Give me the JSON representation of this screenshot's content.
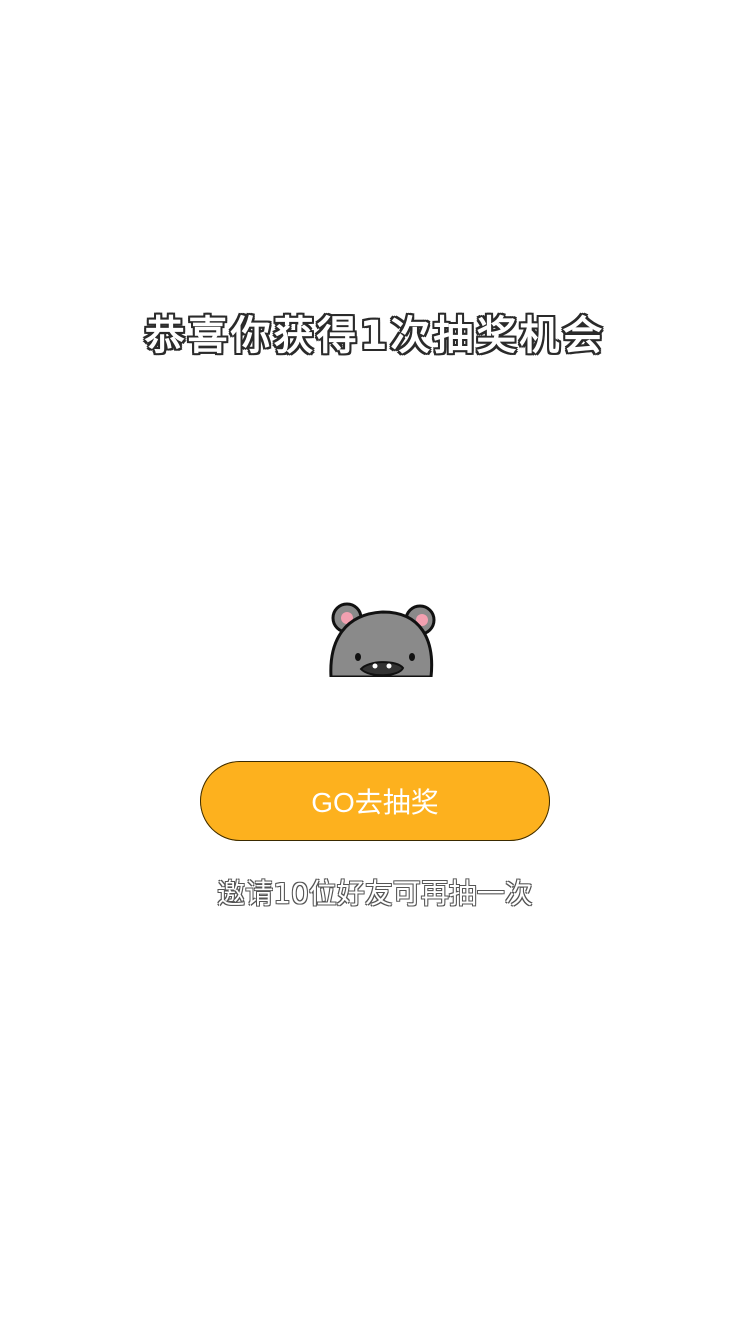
{
  "headline": "恭喜你获得1次抽奖机会",
  "mascot": {
    "icon": "bear-icon"
  },
  "go_button": {
    "label": "GO去抽奖",
    "color": "#fdb11e"
  },
  "invite_text": "邀请10位好友可再抽一次"
}
